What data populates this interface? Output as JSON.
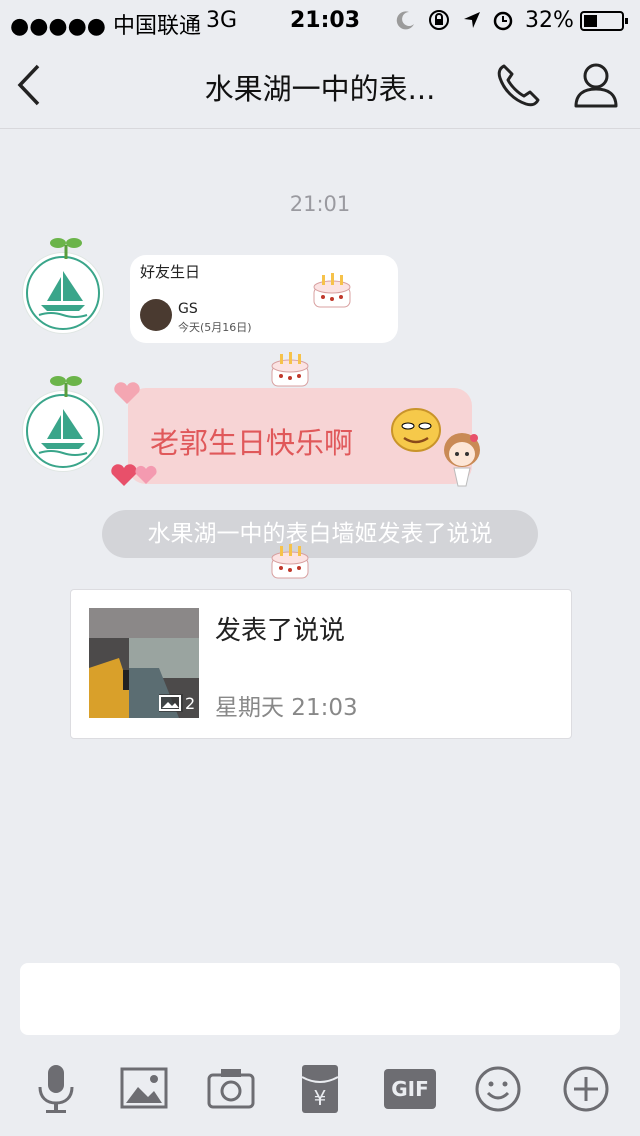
{
  "status_bar": {
    "carrier": "●●●●● 中国联通",
    "network": "3G",
    "time": "21:03",
    "battery": "32%"
  },
  "header": {
    "title": "水果湖一中的表..."
  },
  "chat": {
    "time_separator": "21:01",
    "birthday_card": {
      "title": "好友生日",
      "name": "GS",
      "date": "今天(5月16日)"
    },
    "message_text": "老郭生日快乐啊",
    "system_notice": "水果湖一中的表白墙姬发表了说说",
    "share_card": {
      "title": "发表了说说",
      "time": "星期天 21:03",
      "photo_count": "2"
    }
  },
  "toolbar": {
    "gif_label": "GIF",
    "icons": [
      "microphone-icon",
      "image-icon",
      "camera-icon",
      "red-packet-icon",
      "gif-icon",
      "emoji-icon",
      "plus-icon"
    ]
  },
  "colors": {
    "background": "#ebedf1",
    "bubble_pink": "#f7d4d5",
    "message_text": "#e0585a",
    "icon_gray": "#6d6d72"
  }
}
